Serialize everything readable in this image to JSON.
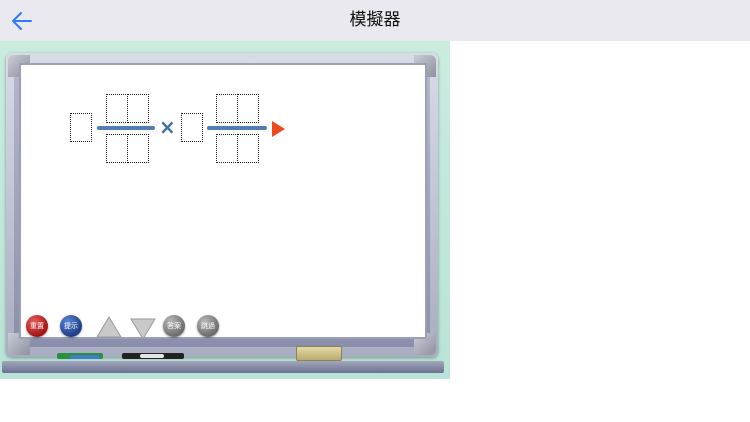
{
  "nav": {
    "title": "模擬器",
    "back_icon": "back-arrow-icon",
    "accent_color": "#2f7cf6"
  },
  "board": {
    "equation": {
      "operator": "×"
    },
    "controls": {
      "reset_label": "重置",
      "hint_label": "提示",
      "up_icon": "triangle-up-icon",
      "down_icon": "triangle-down-icon",
      "answer_label": "答案",
      "skip_label": "跳過"
    }
  }
}
